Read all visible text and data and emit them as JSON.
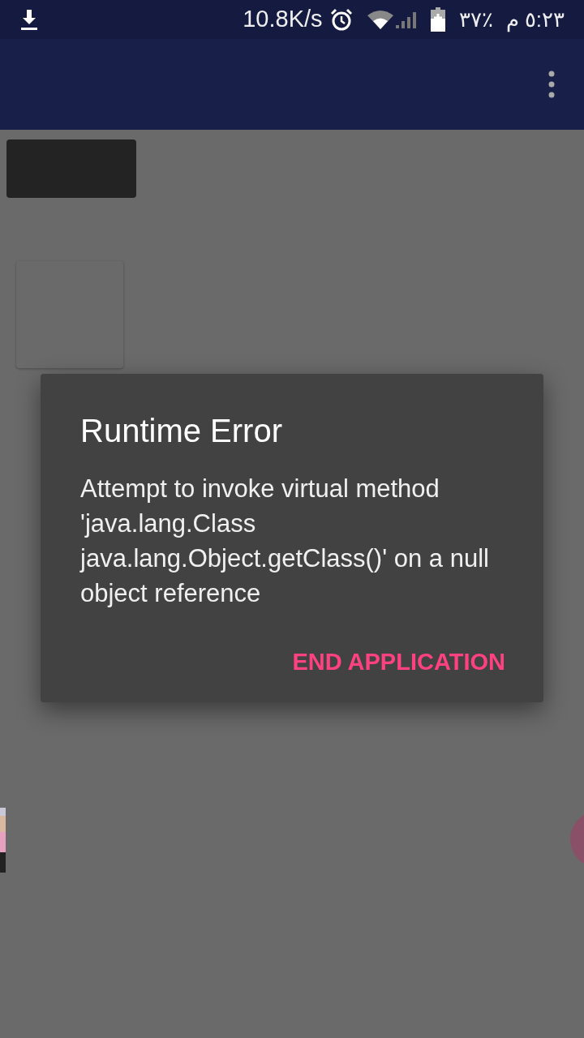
{
  "status_bar": {
    "speed": "10.8K/s",
    "battery": "۳۷٪",
    "time": "٥:٢٣ م"
  },
  "dialog": {
    "title": "Runtime Error",
    "message": "Attempt to invoke virtual method 'java.lang.Class java.lang.Object.getClass()' on a null object reference",
    "button": "END APPLICATION"
  }
}
